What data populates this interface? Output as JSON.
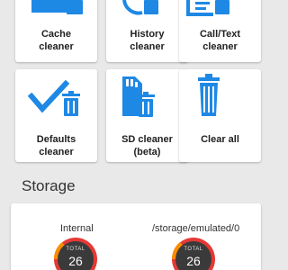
{
  "tiles": [
    {
      "label_lines": [
        "Cache",
        "cleaner"
      ],
      "icon": "storage-trash-icon"
    },
    {
      "label_lines": [
        "History",
        "cleaner"
      ],
      "icon": "history-trash-icon"
    },
    {
      "label_lines": [
        "Call/Text",
        "cleaner"
      ],
      "icon": "message-trash-icon"
    },
    {
      "label_lines": [
        "Defaults",
        "cleaner"
      ],
      "icon": "checkmark-trash-icon"
    },
    {
      "label_lines": [
        "SD cleaner",
        "(beta)"
      ],
      "icon": "sd-card-trash-icon"
    },
    {
      "label_lines": [
        "Clear all"
      ],
      "icon": "trash-can-icon"
    }
  ],
  "storage": {
    "title": "Storage",
    "volumes": [
      {
        "label": "Internal",
        "total_label": "TOTAL",
        "total_value": "26"
      },
      {
        "label": "/storage/emulated/0",
        "total_label": "TOTAL",
        "total_value": "26"
      }
    ]
  },
  "colors": {
    "accent": "#1e88e5",
    "background": "#e9e9e9",
    "card": "#ffffff",
    "gauge_dark": "#3a3a3a",
    "gauge_red": "#e53935",
    "gauge_orange": "#fb8c00"
  }
}
